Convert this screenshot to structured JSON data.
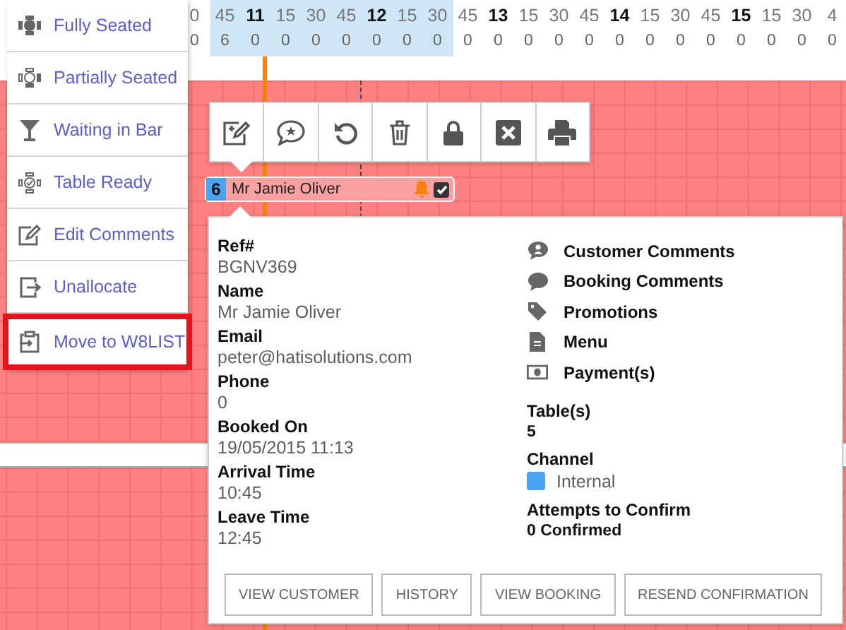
{
  "timeline": {
    "columns": [
      {
        "label": "0",
        "kind": "minute",
        "count": "0",
        "highlighted": false
      },
      {
        "label": "45",
        "kind": "minute",
        "count": "6",
        "highlighted": true
      },
      {
        "label": "11",
        "kind": "hour",
        "count": "0",
        "highlighted": true
      },
      {
        "label": "15",
        "kind": "minute",
        "count": "0",
        "highlighted": true
      },
      {
        "label": "30",
        "kind": "minute",
        "count": "0",
        "highlighted": true
      },
      {
        "label": "45",
        "kind": "minute",
        "count": "0",
        "highlighted": true
      },
      {
        "label": "12",
        "kind": "hour",
        "count": "0",
        "highlighted": true
      },
      {
        "label": "15",
        "kind": "minute",
        "count": "0",
        "highlighted": true
      },
      {
        "label": "30",
        "kind": "minute",
        "count": "0",
        "highlighted": true
      },
      {
        "label": "45",
        "kind": "minute",
        "count": "0",
        "highlighted": false
      },
      {
        "label": "13",
        "kind": "hour",
        "count": "0",
        "highlighted": false
      },
      {
        "label": "15",
        "kind": "minute",
        "count": "0",
        "highlighted": false
      },
      {
        "label": "30",
        "kind": "minute",
        "count": "0",
        "highlighted": false
      },
      {
        "label": "45",
        "kind": "minute",
        "count": "0",
        "highlighted": false
      },
      {
        "label": "14",
        "kind": "hour",
        "count": "0",
        "highlighted": false
      },
      {
        "label": "15",
        "kind": "minute",
        "count": "0",
        "highlighted": false
      },
      {
        "label": "30",
        "kind": "minute",
        "count": "0",
        "highlighted": false
      },
      {
        "label": "45",
        "kind": "minute",
        "count": "0",
        "highlighted": false
      },
      {
        "label": "15",
        "kind": "hour",
        "count": "0",
        "highlighted": false
      },
      {
        "label": "15",
        "kind": "minute",
        "count": "0",
        "highlighted": false
      },
      {
        "label": "30",
        "kind": "minute",
        "count": "0",
        "highlighted": false
      },
      {
        "label": "4",
        "kind": "minute",
        "count": "0",
        "highlighted": false
      }
    ]
  },
  "status_menu": {
    "items": [
      {
        "kind": "fully-seated",
        "label": "Fully Seated",
        "selected": false
      },
      {
        "kind": "partially-seated",
        "label": "Partially Seated",
        "selected": false
      },
      {
        "kind": "waiting-bar",
        "label": "Waiting in Bar",
        "selected": false
      },
      {
        "kind": "table-ready",
        "label": "Table Ready",
        "selected": false
      },
      {
        "kind": "edit",
        "label": "Edit Comments",
        "selected": false
      },
      {
        "kind": "unallocate",
        "label": "Unallocate",
        "selected": false
      },
      {
        "kind": "move",
        "label": "Move to W8LIST",
        "selected": true
      }
    ]
  },
  "action_toolbar": {
    "buttons": [
      {
        "kind": "edit"
      },
      {
        "kind": "review"
      },
      {
        "kind": "undo"
      },
      {
        "kind": "delete"
      },
      {
        "kind": "lock"
      },
      {
        "kind": "cancel"
      },
      {
        "kind": "print"
      }
    ]
  },
  "booking": {
    "covers": "6",
    "name": "Mr Jamie Oliver",
    "alert": true,
    "checked": true,
    "color": "#4aa3f0"
  },
  "details": {
    "fields": [
      {
        "label": "Ref#",
        "value": "BGNV369"
      },
      {
        "label": "Name",
        "value": "Mr Jamie Oliver"
      },
      {
        "label": "Email",
        "value": "peter@hatisolutions.com"
      },
      {
        "label": "Phone",
        "value": "0"
      },
      {
        "label": "Booked On",
        "value": "19/05/2015 11:13"
      },
      {
        "label": "Arrival Time",
        "value": "10:45"
      },
      {
        "label": "Leave Time",
        "value": "12:45"
      }
    ],
    "links": [
      {
        "kind": "customer-comments",
        "label": "Customer Comments"
      },
      {
        "kind": "booking-comments",
        "label": "Booking Comments"
      },
      {
        "kind": "promotions",
        "label": "Promotions"
      },
      {
        "kind": "menu",
        "label": "Menu"
      },
      {
        "kind": "payments",
        "label": "Payment(s)"
      }
    ],
    "tables": {
      "label": "Table(s)",
      "value": "5"
    },
    "channel": {
      "label": "Channel",
      "value": "Internal",
      "color": "#4aa3f0"
    },
    "attempts": {
      "label": "Attempts to Confirm",
      "value": "0 Confirmed"
    },
    "buttons": [
      "VIEW CUSTOMER",
      "HISTORY",
      "VIEW BOOKING",
      "RESEND CONFIRMATION"
    ]
  }
}
